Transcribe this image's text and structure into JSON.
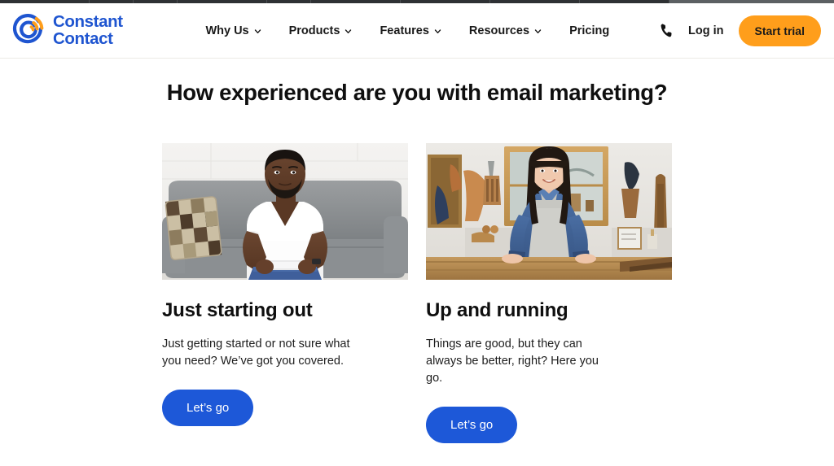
{
  "brand": {
    "logo_icon": "constant-contact-swirl-logo",
    "name_line1": "Constant",
    "name_line2": "Contact",
    "blue": "#1f55d0",
    "orange": "#ff9e1b"
  },
  "header": {
    "nav": [
      {
        "label": "Why Us",
        "has_dropdown": true,
        "icon": "chevron-down-icon"
      },
      {
        "label": "Products",
        "has_dropdown": true,
        "icon": "chevron-down-icon"
      },
      {
        "label": "Features",
        "has_dropdown": true,
        "icon": "chevron-down-icon"
      },
      {
        "label": "Resources",
        "has_dropdown": true,
        "icon": "chevron-down-icon"
      },
      {
        "label": "Pricing",
        "has_dropdown": false,
        "icon": ""
      }
    ],
    "phone_icon": "phone-icon",
    "login_label": "Log in",
    "trial_label": "Start trial"
  },
  "main": {
    "title": "How experienced are you with email marketing?",
    "cards": [
      {
        "image_alt": "man-sitting-on-gray-couch-holding-tablet",
        "title": "Just starting out",
        "description": "Just getting started or not sure what you need? We’ve got you covered.",
        "cta_label": "Let’s go"
      },
      {
        "image_alt": "woman-shopkeeper-standing-behind-wooden-counter",
        "title": "Up and running",
        "description": "Things are good, but they can always be better, right? Here you go.",
        "cta_label": "Let’s go"
      }
    ],
    "cta_color": "#1d58d8"
  }
}
